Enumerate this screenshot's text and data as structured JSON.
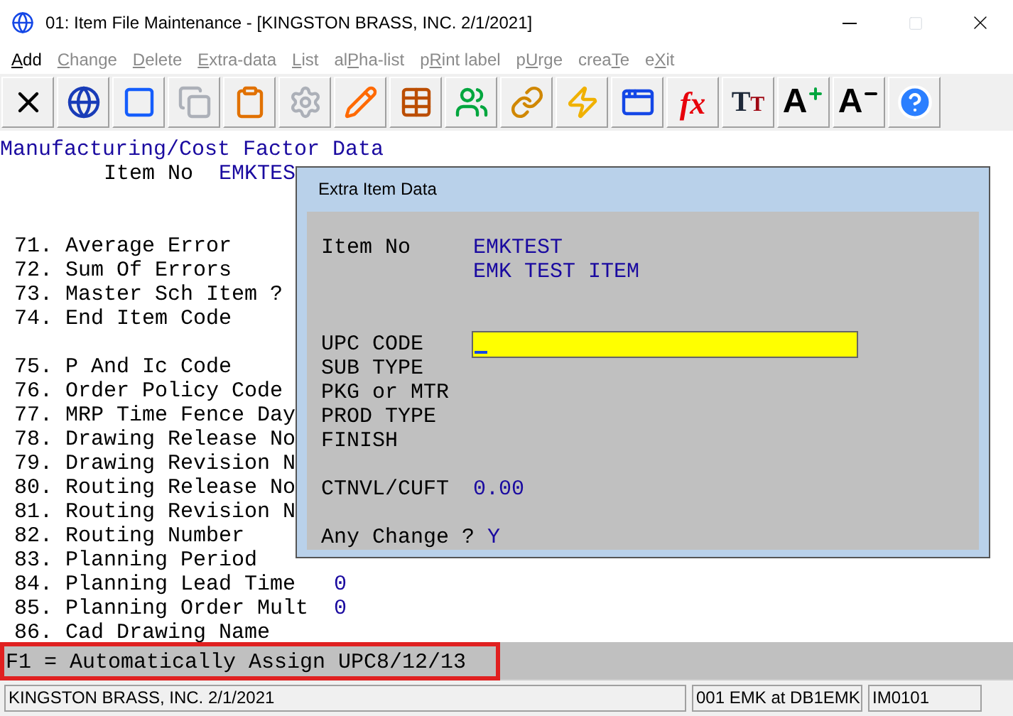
{
  "window": {
    "title": "01: Item File Maintenance - [KINGSTON BRASS, INC. 2/1/2021]",
    "maximize_disabled": true
  },
  "menu": [
    {
      "key": "A",
      "post": "dd",
      "disabled": false
    },
    {
      "key": "C",
      "post": "hange",
      "disabled": true
    },
    {
      "key": "D",
      "post": "elete",
      "disabled": true
    },
    {
      "key": "E",
      "post": "xtra-data",
      "disabled": true
    },
    {
      "key": "L",
      "post": "ist",
      "disabled": true
    },
    {
      "pre": "al",
      "key": "P",
      "post": "ha-list",
      "disabled": true
    },
    {
      "pre": "p",
      "key": "R",
      "post": "int label",
      "disabled": true
    },
    {
      "pre": "p",
      "key": "U",
      "post": "rge",
      "disabled": true
    },
    {
      "pre": "crea",
      "key": "T",
      "post": "e",
      "disabled": true
    },
    {
      "pre": "e",
      "key": "X",
      "post": "it",
      "disabled": true
    }
  ],
  "toolbar": [
    {
      "kind": "icon",
      "disabled": false
    },
    {
      "kind": "icon",
      "disabled": false
    },
    {
      "kind": "icon",
      "disabled": false
    },
    {
      "kind": "icon",
      "disabled": true
    },
    {
      "kind": "icon",
      "disabled": false
    },
    {
      "kind": "icon",
      "disabled": true
    },
    {
      "kind": "icon",
      "disabled": false
    },
    {
      "kind": "icon",
      "disabled": false
    },
    {
      "kind": "icon",
      "disabled": false
    },
    {
      "kind": "icon",
      "disabled": false
    },
    {
      "kind": "icon",
      "disabled": false
    },
    {
      "kind": "icon",
      "disabled": false
    },
    {
      "kind": "formula",
      "label": "fx",
      "disabled": false
    },
    {
      "kind": "fonts",
      "label": "T",
      "label2": "T",
      "disabled": false
    },
    {
      "kind": "grow",
      "label": "A",
      "disabled": false
    },
    {
      "kind": "shrink",
      "label": "A",
      "disabled": false
    },
    {
      "kind": "icon",
      "disabled": false
    }
  ],
  "screen": {
    "heading": "Manufacturing/Cost Factor Data",
    "item_label": "Item No",
    "item_value": "EMKTES",
    "groups": [
      [
        {
          "label": "71. Average Error"
        },
        {
          "label": "72. Sum Of Errors"
        },
        {
          "label": "73. Master Sch Item ?"
        },
        {
          "label": "74. End Item Code"
        }
      ],
      [
        {
          "label": "75. P And Ic Code"
        },
        {
          "label": "76. Order Policy Code"
        },
        {
          "label": "77. MRP Time Fence Day"
        },
        {
          "label": "78. Drawing Release No"
        },
        {
          "label": "79. Drawing Revision N"
        },
        {
          "label": "80. Routing Release No"
        },
        {
          "label": "81. Routing Revision N"
        },
        {
          "label": "82. Routing Number"
        },
        {
          "label": "83. Planning Period"
        },
        {
          "label": "84. Planning Lead Time",
          "value": "0"
        },
        {
          "label": "85. Planning Order Mult",
          "value": "0"
        },
        {
          "label": "86. Cad Drawing Name"
        }
      ]
    ],
    "hint": "F1 = Automatically Assign UPC8/12/13"
  },
  "dialog": {
    "title": "Extra Item Data",
    "item_label": "Item No",
    "item_value": "EMKTEST",
    "item_description": "EMK TEST ITEM",
    "fields": [
      {
        "label": "UPC CODE",
        "kind": "input"
      },
      {
        "label": "SUB TYPE",
        "kind": "plain"
      },
      {
        "label": "PKG or MTR",
        "kind": "plain"
      },
      {
        "label": "PROD TYPE",
        "kind": "plain"
      },
      {
        "label": "FINISH",
        "kind": "plain"
      }
    ],
    "cuft_label": "CTNVL/CUFT",
    "cuft_value": "0.00",
    "prompt": "Any Change ?",
    "answer": "Y"
  },
  "status_bar": [
    "KINGSTON BRASS, INC. 2/1/2021",
    "001 EMK at DB1EMK",
    "IM0101"
  ]
}
